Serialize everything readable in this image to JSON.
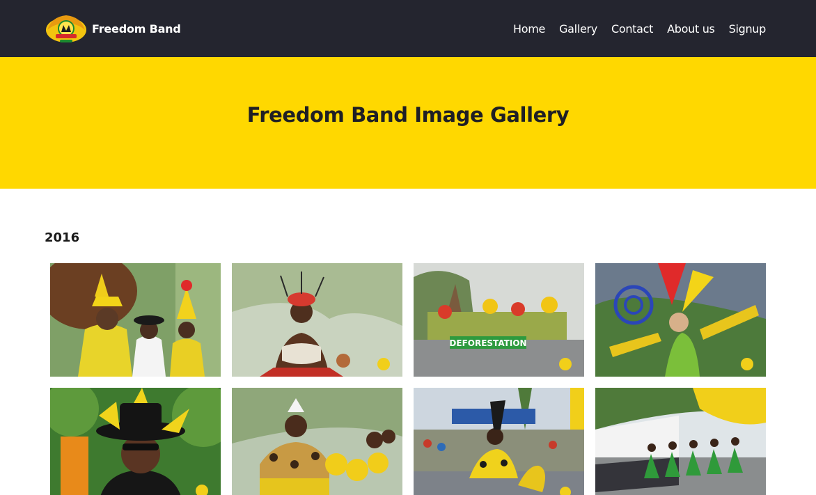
{
  "brand": {
    "name": "Freedom Band",
    "logo_icon": "freedom-carnival-logo-icon"
  },
  "nav": {
    "items": [
      {
        "label": "Home"
      },
      {
        "label": "Gallery"
      },
      {
        "label": "Contact"
      },
      {
        "label": "About us"
      },
      {
        "label": "Signup"
      }
    ]
  },
  "hero": {
    "title": "Freedom Band Image Gallery"
  },
  "gallery": {
    "sections": [
      {
        "year": "2016",
        "photos": [
          {
            "subject": "costumed-revelers-portrait-photo"
          },
          {
            "subject": "beaded-dancer-photo"
          },
          {
            "subject": "deforestation-float-photo",
            "caption": "DEFORESTATION"
          },
          {
            "subject": "feathered-masquerade-dancer-photo"
          },
          {
            "subject": "man-in-black-hat-photo"
          },
          {
            "subject": "leopard-costume-dancers-photo"
          },
          {
            "subject": "crouching-dancers-parade-photo"
          },
          {
            "subject": "green-costume-dancers-line-photo"
          }
        ]
      }
    ]
  },
  "colors": {
    "nav_bg": "#24252f",
    "hero_bg": "#ffd800",
    "accent_yellow": "#f5d400"
  }
}
